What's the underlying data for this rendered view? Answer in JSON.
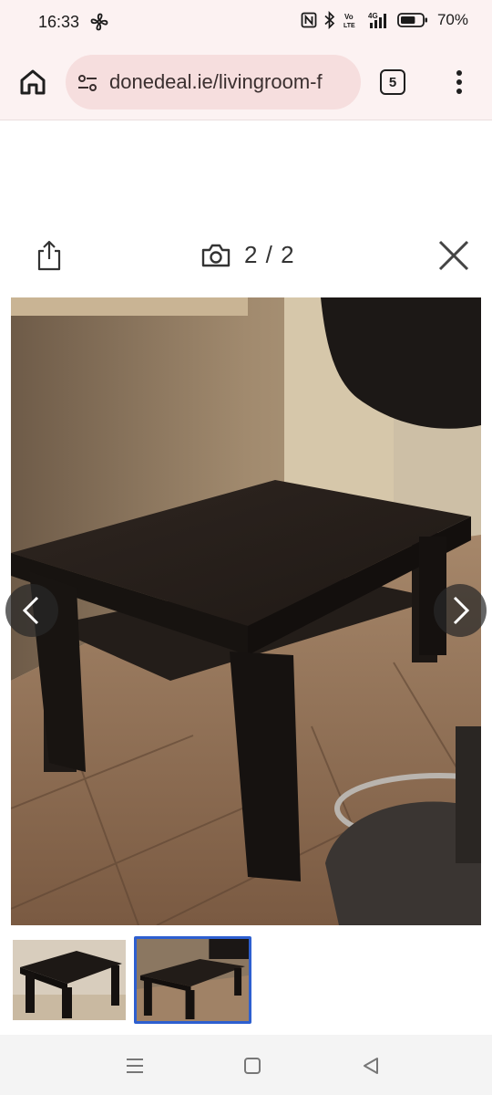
{
  "status_bar": {
    "time": "16:33",
    "battery_percent": "70%",
    "battery_level": 0.7,
    "volte_top": "Vo",
    "volte_bottom": "LTE",
    "network": "4G"
  },
  "browser": {
    "url": "donedeal.ie/livingroom-f",
    "tab_count": "5",
    "bar_color": "#fcf2f2",
    "pill_color": "#f6dede"
  },
  "gallery": {
    "counter": "2 / 2",
    "selected_thumb_border": "#2d5fd0"
  },
  "icons": {
    "home": "home-icon",
    "site_settings": "tune-icon",
    "menu": "more-vert-icon",
    "share": "share-icon",
    "camera": "camera-icon",
    "close": "close-icon",
    "prev": "chevron-left-icon",
    "next": "chevron-right-icon"
  }
}
